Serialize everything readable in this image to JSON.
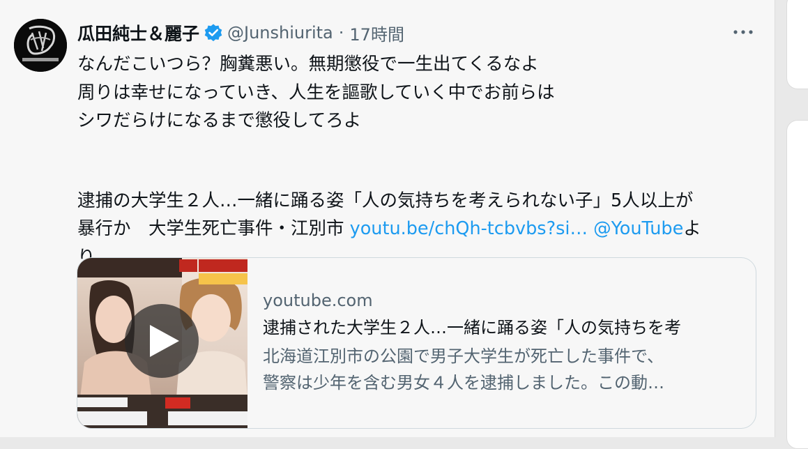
{
  "tweet": {
    "display_name": "瓜田純士＆麗子",
    "handle": "@Junshiurita",
    "separator": "·",
    "time": "17時間",
    "avatar_icon": "profile-logo",
    "verified_icon": "verified-badge-icon",
    "more_icon": "more-options-icon",
    "body_lines": [
      "なんだこいつら？胸糞悪い。無期懲役で一生出てくるなよ",
      "周りは幸せになっていき、人生を謳歌していく中でお前らは",
      "シワだらけになるまで懲役してろよ",
      "逮捕の大学生２人…一緒に踊る姿「人の気持ちを考えられない子」5人以上が"
    ],
    "line5_prefix": "暴行か　大学生死亡事件・江別市 ",
    "link_url_text": "youtu.be/chQh-tcbvbs?si…",
    "link_mention": "@YouTube",
    "line5_suffix": "よ",
    "line6": "り",
    "colors": {
      "link": "#1d9bf0",
      "verified": "#1d9bf0",
      "text": "#0f1419",
      "secondary": "#536471"
    }
  },
  "card": {
    "domain": "youtube.com",
    "title": "逮捕された大学生２人…一緒に踊る姿「人の気持ちを考",
    "desc_line1": "北海道江別市の公園で男子大学生が死亡した事件で、",
    "desc_line2": "警察は少年を含む男女４人を逮捕しました。この動…",
    "thumbnail_icon": "video-thumbnail",
    "play_icon": "play-icon"
  }
}
